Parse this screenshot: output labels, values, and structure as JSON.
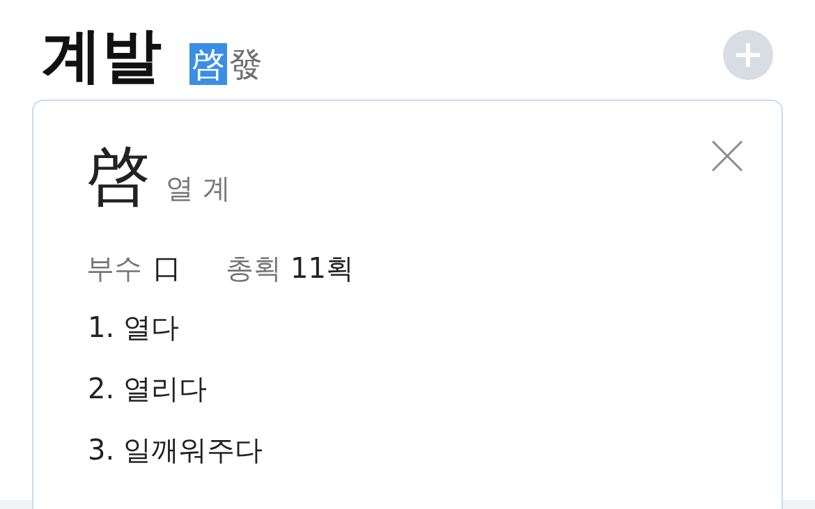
{
  "header": {
    "word": "계발",
    "hanja": [
      {
        "char": "啓",
        "selected": true
      },
      {
        "char": "發",
        "selected": false
      }
    ]
  },
  "detail_card": {
    "character": "啓",
    "reading": "열 계",
    "radical_label": "부수",
    "radical": "口",
    "strokes_label": "총획",
    "strokes": "11획",
    "meanings": [
      "1. 열다",
      "2. 열리다",
      "3. 일깨워주다"
    ]
  }
}
